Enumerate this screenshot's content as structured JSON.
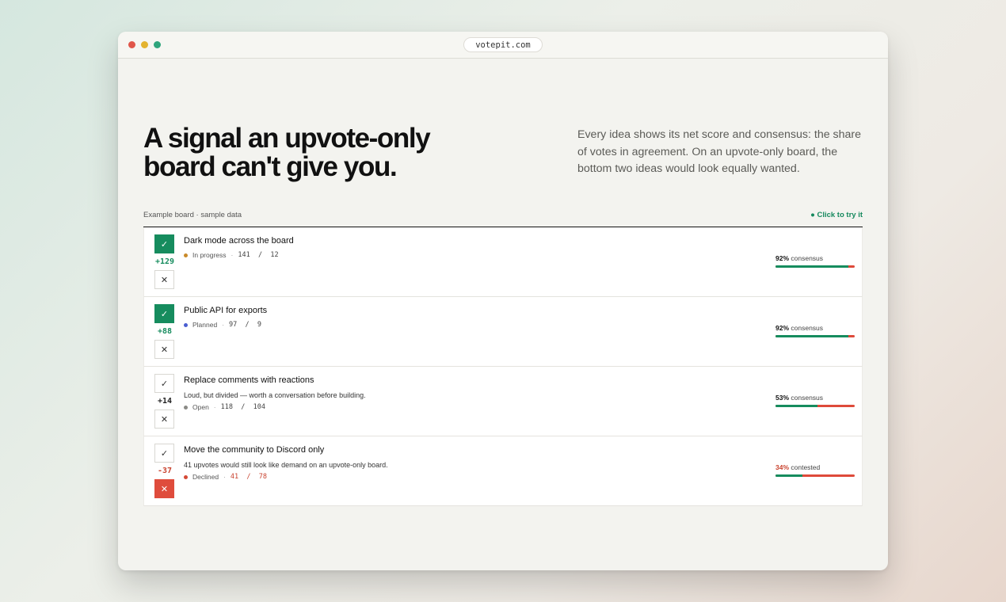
{
  "browser": {
    "url": "votepit.com"
  },
  "hero": {
    "headline_line1": "A signal an upvote-only",
    "headline_line2": "board can't give you.",
    "description": "Every idea shows its net score and consensus: the share of votes in agreement. On an upvote-only board, the bottom two ideas would look equally wanted."
  },
  "board": {
    "label": "Example board · sample data",
    "try_it": "● Click to try it",
    "up_icon": "✓",
    "down_icon": "✕",
    "count_separator": "/",
    "rows": [
      {
        "title": "Dark mode across the board",
        "note": "",
        "score": "+129",
        "status": "In progress",
        "status_color": "#c98a2a",
        "up": "141",
        "down": "12",
        "consensus_pct": "92%",
        "consensus_label": "consensus",
        "agreement_fraction": 0.92,
        "vote": "up"
      },
      {
        "title": "Public API for exports",
        "note": "",
        "score": "+88",
        "status": "Planned",
        "status_color": "#4a5ed1",
        "up": "97",
        "down": "9",
        "consensus_pct": "92%",
        "consensus_label": "consensus",
        "agreement_fraction": 0.92,
        "vote": "up"
      },
      {
        "title": "Replace comments with reactions",
        "note": "Loud, but divided — worth a conversation before building.",
        "score": "+14",
        "status": "Open",
        "status_color": "#8a8a86",
        "up": "118",
        "down": "104",
        "consensus_pct": "53%",
        "consensus_label": "consensus",
        "agreement_fraction": 0.53,
        "vote": "none"
      },
      {
        "title": "Move the community to Discord only",
        "note": "41 upvotes would still look like demand on an upvote-only board.",
        "score": "-37",
        "status": "Declined",
        "status_color": "#d44a36",
        "up": "41",
        "down": "78",
        "consensus_pct": "34%",
        "consensus_label": "contested",
        "agreement_fraction": 0.34,
        "vote": "down"
      }
    ]
  },
  "colors": {
    "accent_green": "#168c5e",
    "accent_red": "#df4c3c"
  }
}
